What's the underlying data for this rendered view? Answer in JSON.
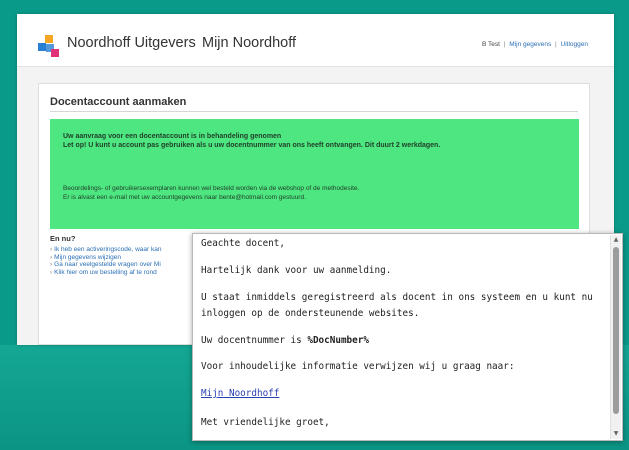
{
  "header": {
    "brand": "Noordhoff Uitgevers",
    "site_name": "Mijn Noordhoff",
    "user_name": "B Test",
    "separator": "|",
    "nav_links": [
      "Mijn gegevens",
      "Uitloggen"
    ]
  },
  "card": {
    "title": "Docentaccount aanmaken",
    "notice": {
      "bold_line_1": "Uw aanvraag voor een docentaccount is in behandeling genomen",
      "bold_line_2": "Let op! U kunt u account pas gebruiken als u uw docentnummer van ons heeft ontvangen. Dit duurt 2 werkdagen.",
      "line_3": "Beoordelings- of gebruikersexemplaren kunnen wel besteld worden via de webshop of de methodesite.",
      "line_4": "Er is alvast een e-mail met uw accountgegevens naar bente@hotmail.com gestuurd.",
      "bg_color": "#4de680"
    },
    "next_title": "En nu?",
    "links": [
      "Ik heb een activeringscode, waar kan",
      "Mijn gegevens wijzigen",
      "Ga naar veelgestelde vragen over Mi",
      "Klik hier om uw bestelling af te rond"
    ]
  },
  "email": {
    "greeting": "Geachte docent,",
    "thanks": "Hartelijk dank voor uw aanmelding.",
    "registered": "U staat inmiddels geregistreerd als docent in ons systeem en u kunt nu inloggen op de ondersteunende websites.",
    "docnumber_prefix": "Uw docentnummer is ",
    "docnumber_value": "%DocNumber%",
    "info": "Voor inhoudelijke informatie verwijzen wij u graag naar:",
    "link": "Mijn Noordhoff",
    "closing": "Met vriendelijke groet,"
  },
  "colors": {
    "teal_background": "#0a9a8a",
    "link_blue": "#2a6fb5",
    "logo_orange": "#f5a623",
    "logo_blue": "#2a7fd4",
    "logo_magenta": "#e0317a"
  },
  "icons": [
    "noordhoff-logo-icon",
    "chevron-right-icon",
    "scroll-up-icon",
    "scroll-down-icon"
  ]
}
